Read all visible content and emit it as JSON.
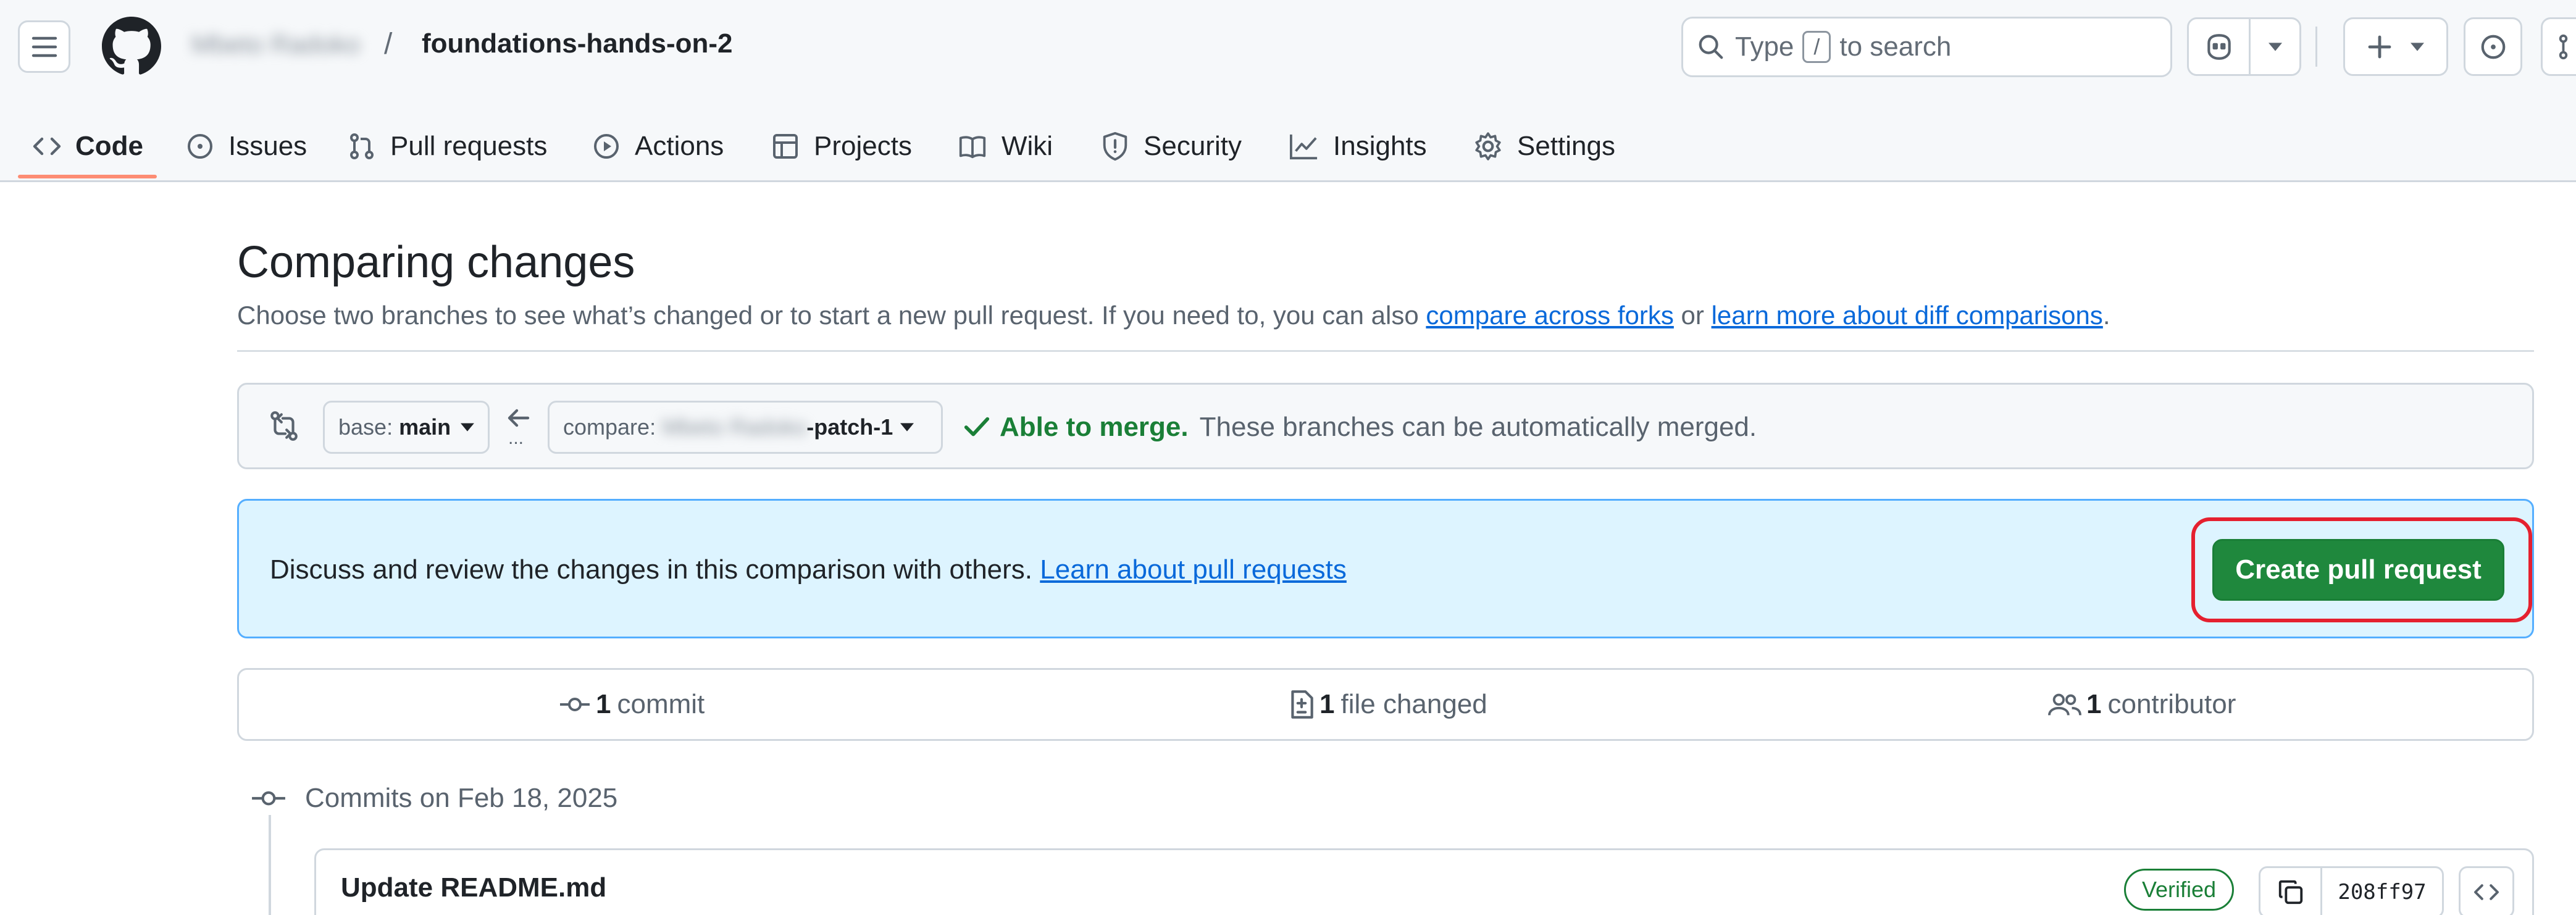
{
  "header": {
    "owner": "Mbeto Radoko",
    "separator": "/",
    "repo": "foundations-hands-on-2",
    "search": {
      "prefix": "Type",
      "key": "/",
      "suffix": "to search"
    },
    "icons": [
      "hamburger-icon",
      "github-logo-icon",
      "search-icon",
      "copilot-icon",
      "chevron-down-icon",
      "plus-icon",
      "issue-opened-icon",
      "pull-request-icon"
    ]
  },
  "nav": {
    "items": [
      {
        "label": "Code",
        "icon": "code-icon",
        "active": true
      },
      {
        "label": "Issues",
        "icon": "issue-opened-icon"
      },
      {
        "label": "Pull requests",
        "icon": "git-pull-request-icon"
      },
      {
        "label": "Actions",
        "icon": "play-icon"
      },
      {
        "label": "Projects",
        "icon": "table-icon"
      },
      {
        "label": "Wiki",
        "icon": "book-icon"
      },
      {
        "label": "Security",
        "icon": "shield-icon"
      },
      {
        "label": "Insights",
        "icon": "graph-icon"
      },
      {
        "label": "Settings",
        "icon": "gear-icon"
      }
    ]
  },
  "compare": {
    "title": "Comparing changes",
    "subtitle_pre": "Choose two branches to see what’s changed or to start a new pull request. If you need to, you can also",
    "link_forks": "compare across forks",
    "subtitle_mid": "or",
    "link_learn": "learn more about diff comparisons",
    "subtitle_end": ".",
    "base_prefix": "base:",
    "base_branch": "main",
    "compare_prefix": "compare:",
    "compare_owner": "Mbeto Radoko",
    "compare_branch": "-patch-1",
    "ellipsis": "...",
    "merge_status": "Able to merge.",
    "merge_detail": "These branches can be automatically merged."
  },
  "flash": {
    "text": "Discuss and review the changes in this comparison with others.",
    "link": "Learn about pull requests",
    "button": "Create pull request"
  },
  "stats": {
    "commits_count": "1",
    "commits_label": "commit",
    "files_count": "1",
    "files_label": "file changed",
    "contributors_count": "1",
    "contributors_label": "contributor"
  },
  "commits": {
    "heading": "Commits on Feb 18, 2025",
    "items": [
      {
        "title": "Update README.md",
        "badge": "Verified",
        "sha": "208ff97"
      }
    ]
  },
  "colors": {
    "accent": "#0969da",
    "success": "#1f883d",
    "flash_bg": "#ddf4ff",
    "highlight": "#e5202f",
    "nav_underline": "#fd8c73"
  }
}
